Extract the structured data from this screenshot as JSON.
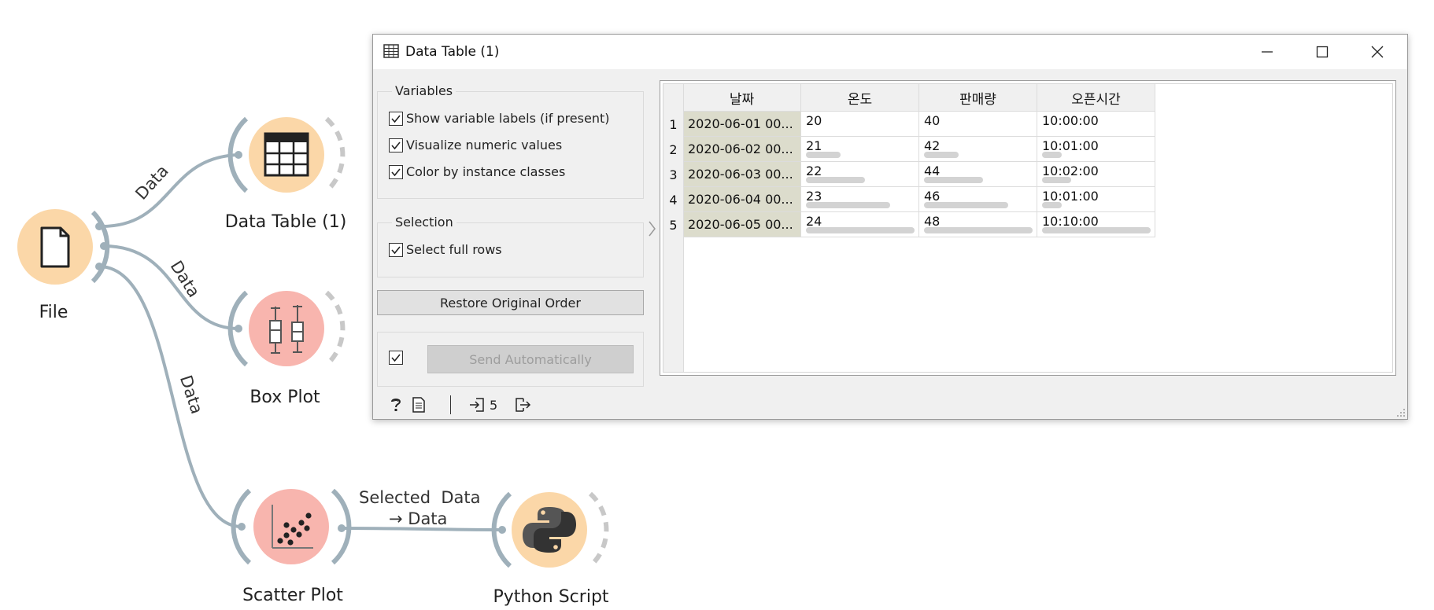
{
  "workflow": {
    "nodes": {
      "file": {
        "label": "File",
        "icon": "file-icon"
      },
      "data_table": {
        "label": "Data Table (1)",
        "icon": "table-icon"
      },
      "box_plot": {
        "label": "Box Plot",
        "icon": "box-plot-icon"
      },
      "scatter_plot": {
        "label": "Scatter Plot",
        "icon": "scatter-plot-icon"
      },
      "python_script": {
        "label": "Python Script",
        "icon": "python-icon"
      }
    },
    "links": {
      "file_to_table": "Data",
      "file_to_boxplot": "Data",
      "file_to_scatter": "Data",
      "scatter_to_python_line1": "Selected  Data",
      "scatter_to_python_line2": "→ Data"
    },
    "colors": {
      "orange_node": "#fbd7a8",
      "red_node": "#f8b5ae",
      "link": "#9fb0ba"
    }
  },
  "window": {
    "title": "Data Table (1)",
    "controls": {
      "minimize": "minimize-icon",
      "maximize": "maximize-icon",
      "close": "close-icon"
    }
  },
  "panel": {
    "variables": {
      "title": "Variables",
      "options": [
        {
          "label": "Show variable labels (if present)",
          "checked": true
        },
        {
          "label": "Visualize numeric values",
          "checked": true
        },
        {
          "label": "Color by instance classes",
          "checked": true
        }
      ]
    },
    "selection": {
      "title": "Selection",
      "options": [
        {
          "label": "Select full rows",
          "checked": true
        }
      ]
    },
    "restore_button": "Restore Original Order",
    "send_auto_checked": true,
    "send_button": "Send Automatically"
  },
  "table": {
    "columns": [
      "날짜",
      "온도",
      "판매량",
      "오픈시간"
    ],
    "rows": [
      {
        "n": "1",
        "date": "2020-06-01 00...",
        "temp": "20",
        "sales": "40",
        "open": "10:00:00"
      },
      {
        "n": "2",
        "date": "2020-06-02 00...",
        "temp": "21",
        "sales": "42",
        "open": "10:01:00"
      },
      {
        "n": "3",
        "date": "2020-06-03 00...",
        "temp": "22",
        "sales": "44",
        "open": "10:02:00"
      },
      {
        "n": "4",
        "date": "2020-06-04 00...",
        "temp": "23",
        "sales": "46",
        "open": "10:01:00"
      },
      {
        "n": "5",
        "date": "2020-06-05 00...",
        "temp": "24",
        "sales": "48",
        "open": "10:10:00"
      }
    ],
    "bar_fraction": {
      "temp": [
        0.0,
        0.25,
        0.5,
        0.75,
        1.0
      ],
      "sales": [
        0.0,
        0.25,
        0.5,
        0.75,
        1.0
      ],
      "open": [
        0.0,
        0.1,
        0.2,
        0.1,
        1.0
      ]
    },
    "date_cell_color": "#dcdccc",
    "bar_color": "#d3d3d3"
  },
  "statusbar": {
    "help_icon": "help-icon",
    "report_icon": "report-icon",
    "input_icon": "input-icon",
    "input_count": "5",
    "output_icon": "output-icon"
  }
}
